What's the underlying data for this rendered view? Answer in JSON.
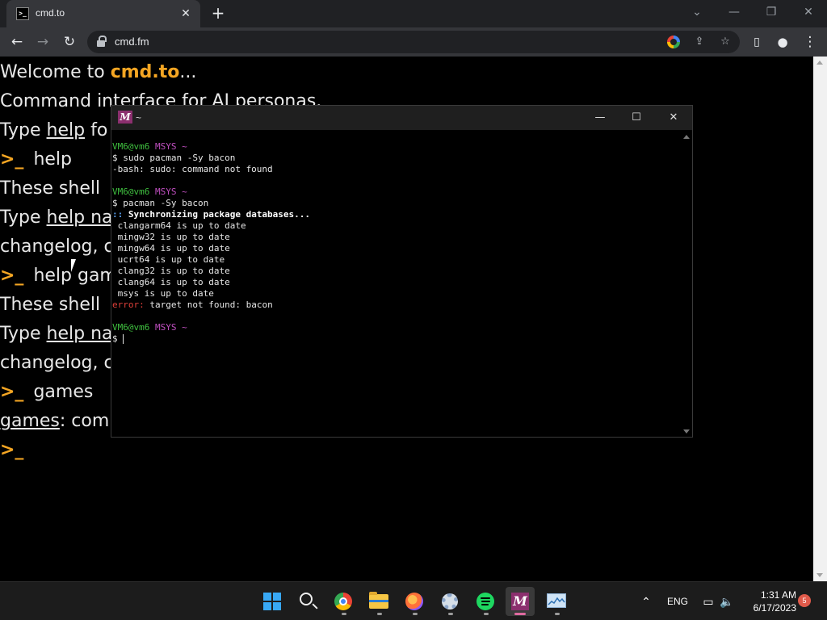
{
  "browser": {
    "tab_title": "cmd.to",
    "tab_favicon": ">_",
    "url": "cmd.fm"
  },
  "page": {
    "line1_prefix": "Welcome to ",
    "line1_brand": "cmd.to",
    "line1_suffix": "...",
    "line2": "Command interface for AI personas.",
    "line3_prefix": "Type ",
    "line3_link": "help",
    "line3_suffix": " fo",
    "prompt_symbol": ">_",
    "cmd1": "help",
    "line5": "These shell",
    "line6_prefix": "Type ",
    "line6_link": "help na",
    "line7": "changelog, c",
    "cmd2": "help gam",
    "line9": "These shell",
    "line10_prefix": "Type ",
    "line10_link": "help na",
    "line11": "changelog, c",
    "cmd3": "games",
    "line13_link": "games",
    "line13_suffix": ": com"
  },
  "terminal": {
    "title": "~",
    "logo": "M",
    "lines": {
      "p1_user": "VM6@vm6",
      "p1_env": "MSYS",
      "p1_dir": "~",
      "c1": "$ sudo pacman -Sy bacon",
      "o1": "-bash: sudo: command not found",
      "p2_user": "VM6@vm6",
      "p2_env": "MSYS",
      "p2_dir": "~",
      "c2": "$ pacman -Sy bacon",
      "o2_prefix": "::",
      "o2": " Synchronizing package databases...",
      "o3": " clangarm64 is up to date",
      "o4": " mingw32 is up to date",
      "o5": " mingw64 is up to date",
      "o6": " ucrt64 is up to date",
      "o7": " clang32 is up to date",
      "o8": " clang64 is up to date",
      "o9": " msys is up to date",
      "err_label": "error:",
      "err_msg": " target not found: bacon",
      "p3_user": "VM6@vm6",
      "p3_env": "MSYS",
      "p3_dir": "~",
      "c3": "$ "
    }
  },
  "taskbar": {
    "language": "ENG",
    "time": "1:31 AM",
    "date": "6/17/2023",
    "notifications": "5"
  },
  "colors": {
    "brand_orange": "#f5a623",
    "prompt_green": "#3fbf3f",
    "env_magenta": "#c04fc0",
    "error_red": "#e0403a"
  },
  "icons": [
    "terminal-favicon-icon",
    "close-icon",
    "plus-icon",
    "back-arrow-icon",
    "forward-arrow-icon",
    "reload-icon",
    "lock-icon",
    "google-icon",
    "share-icon",
    "star-icon",
    "sidepanel-icon",
    "profile-icon",
    "kebab-menu-icon",
    "windows-start-icon",
    "search-icon",
    "chrome-icon",
    "file-explorer-icon",
    "firefox-icon",
    "settings-gear-icon",
    "spotify-icon",
    "msys2-icon",
    "resource-monitor-icon",
    "chevron-up-icon",
    "network-icon",
    "volume-icon"
  ]
}
